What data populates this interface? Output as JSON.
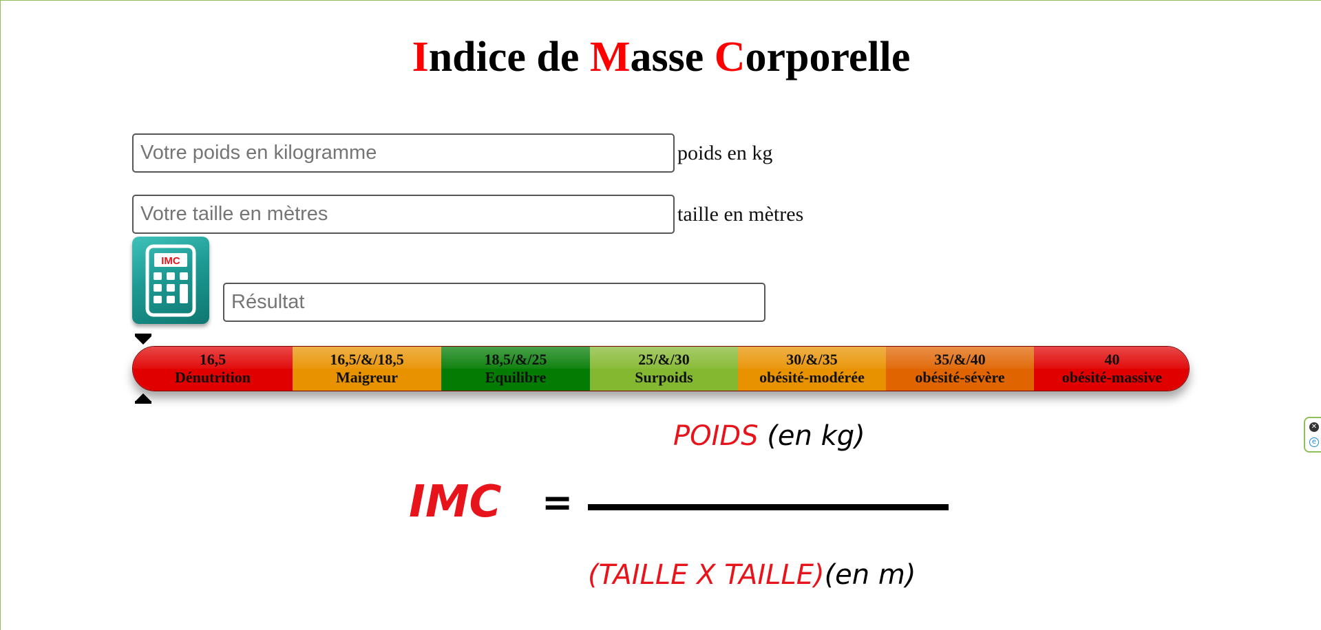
{
  "title": {
    "cap1": "I",
    "rest1": "ndice de ",
    "cap2": "M",
    "rest2": "asse ",
    "cap3": "C",
    "rest3": "orporelle"
  },
  "colors": {
    "accent_red": "#ff0000",
    "teal": "#1d9a93"
  },
  "form": {
    "weight_placeholder": "Votre poids en kilogramme",
    "weight_value": "",
    "weight_unit": "poids en kg",
    "height_placeholder": "Votre taille en mètres",
    "height_value": "",
    "height_unit": "taille en mètres",
    "result_placeholder": "Résultat",
    "result_value": ""
  },
  "calculator_icon": {
    "icon": "calculator-icon",
    "label": "IMC"
  },
  "scale": {
    "segments": [
      {
        "range": "16,5",
        "label": "Dénutrition",
        "color": "#e00000"
      },
      {
        "range": "16,5/&/18,5",
        "label": "Maigreur",
        "color": "#e89200"
      },
      {
        "range": "18,5/&/25",
        "label": "Equilibre",
        "color": "#047c04"
      },
      {
        "range": "25/&/30",
        "label": "Surpoids",
        "color": "#84b830"
      },
      {
        "range": "30/&/35",
        "label": "obésité-modérée",
        "color": "#e89200"
      },
      {
        "range": "35/&/40",
        "label": "obésité-sévère",
        "color": "#e06400"
      },
      {
        "range": "40",
        "label": "obésité-massive",
        "color": "#e00000"
      }
    ]
  },
  "formula": {
    "numerator_red": "POIDS",
    "numerator_black": " (en kg)",
    "imc": "IMC",
    "equals": "=",
    "denominator_red": "(TAILLE X TAILLE)",
    "denominator_black": "(en m)"
  },
  "side_widget": {
    "close_icon": "close-icon",
    "close_glyph": "✕",
    "ext_icon": "extension-icon",
    "ext_glyph": "e"
  }
}
